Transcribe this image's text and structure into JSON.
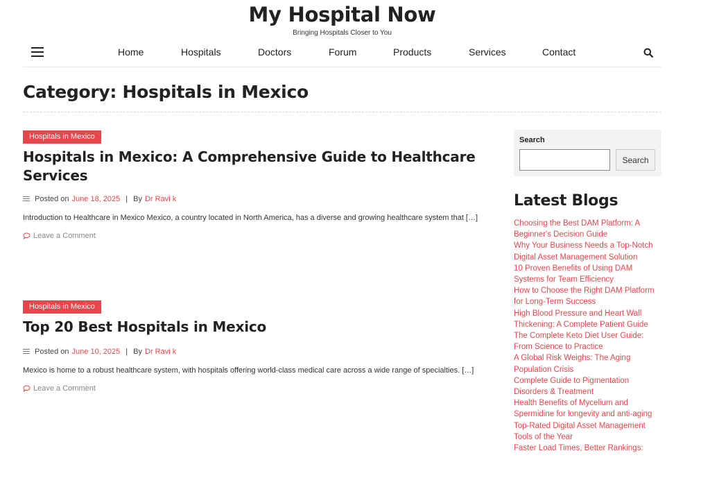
{
  "site": {
    "title": "My Hospital Now",
    "tagline": "Bringing Hospitals Closer to You"
  },
  "nav": {
    "items": [
      {
        "label": "Home"
      },
      {
        "label": "Hospitals"
      },
      {
        "label": "Doctors"
      },
      {
        "label": "Forum"
      },
      {
        "label": "Products"
      },
      {
        "label": "Services"
      },
      {
        "label": "Contact"
      }
    ]
  },
  "page": {
    "category_title": "Category: Hospitals in Mexico"
  },
  "posts": [
    {
      "category": "Hospitals in Mexico",
      "title": "Hospitals in Mexico: A Comprehensive Guide to Healthcare Services",
      "posted_on_label": "Posted on",
      "date": "June 18, 2025",
      "sep": "|",
      "by_label": "By",
      "author": "Dr Ravi k",
      "excerpt": "Introduction to Healthcare in Mexico Mexico, a country located in North America, has a diverse and growing healthcare system that […]",
      "comment_label": "Leave a Comment"
    },
    {
      "category": "Hospitals in Mexico",
      "title": "Top 20 Best Hospitals in Mexico",
      "posted_on_label": "Posted on",
      "date": "June 10, 2025",
      "sep": "|",
      "by_label": "By",
      "author": "Dr Ravi k",
      "excerpt": "Mexico is home to a robust healthcare system, with hospitals offering world-class medical care across a wide range of specialties. […]",
      "comment_label": "Leave a Comment"
    }
  ],
  "sidebar": {
    "search_label": "Search",
    "search_value": "",
    "search_button": "Search",
    "latest_title": "Latest Blogs",
    "latest_items": [
      "Choosing the Best DAM Platform: A Beginner's Decision Guide",
      "Why Your Business Needs a Top-Notch Digital Asset Management Solution",
      "10 Proven Benefits of Using DAM Systems for Team Efficiency",
      "How to Choose the Right DAM Platform for Long-Term Success",
      "High Blood Pressure and Heart Wall Thickening: A Complete Patient Guide",
      "The Complete Keto Diet User Guide: From Science to Practice",
      "A Global Risk Weighs: The Aging Population Crisis",
      "Complete Guide to Pigmentation Disorders & Treatment",
      "Health Benefits of Mycelium and Spermidine for longevity and anti-aging",
      "Top-Rated Digital Asset Management Tools of the Year",
      "Faster Load Times, Better Rankings:"
    ]
  },
  "icons": {
    "menu": "hamburger-menu-icon",
    "search": "search-icon",
    "meta": "list-icon",
    "comment": "comment-icon"
  },
  "colors": {
    "accent": "#e5474b",
    "text": "#222222",
    "muted": "#888888",
    "widget_bg": "#f3f3f3"
  }
}
